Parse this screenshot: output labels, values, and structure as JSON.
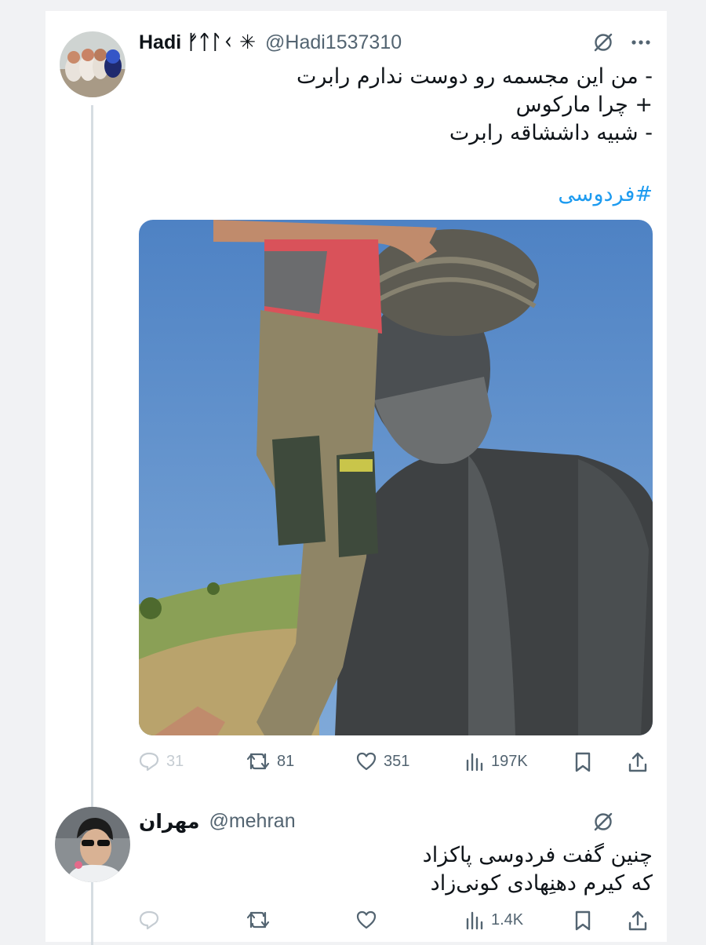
{
  "tweet": {
    "display_name": "Hadi ᚠᛏᛚᚲ ✳",
    "handle": "@Hadi1537310",
    "lines": [
      "- من این مجسمه رو دوست ندارم رابرت",
      "+ چرا مارکوس",
      "- شبیه داششاقه رابرت"
    ],
    "hashtag": "#فردوسی",
    "stats": {
      "replies": "31",
      "retweets": "81",
      "likes": "351",
      "views": "197K"
    },
    "icons": [
      "grok-icon",
      "more-icon",
      "reply-icon",
      "retweet-icon",
      "like-icon",
      "views-icon",
      "bookmark-icon",
      "share-icon"
    ]
  },
  "reply": {
    "display_name": "مهران",
    "handle": "@mehran",
    "lines": [
      "چنین گفت فردوسی پاکزاد",
      "که کیرم دهنِهادی کونی‌زاد"
    ],
    "stats": {
      "views": "1.4K"
    }
  },
  "colors": {
    "link": "#1d9bf0",
    "muted": "#536471",
    "thread_line": "#d6dde2",
    "sky": "#5f8ec9"
  }
}
